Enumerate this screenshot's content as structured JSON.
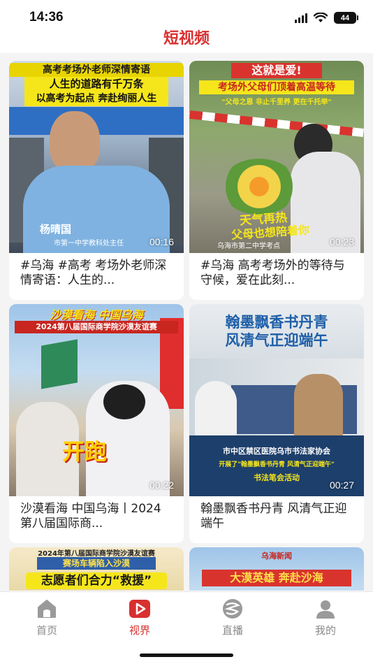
{
  "status_bar": {
    "time": "14:36",
    "battery": "44"
  },
  "header": {
    "title": "短视频"
  },
  "videos": [
    {
      "banner_lines": [
        "高考考场外老师深情寄语",
        "人生的道路有千万条",
        "以高考为起点 奔赴绚丽人生"
      ],
      "overlay_name": "杨晴国",
      "overlay_role": "市第一中学教科处主任",
      "duration": "00:16",
      "caption": "#乌海 #高考 考场外老师深情寄语：人生的..."
    },
    {
      "banner_lines": [
        "这就是爱!",
        "考场外父母们顶着高温等待",
        "\"父母之恩 非止千里养 更在千托举\"",
        "天气再热",
        "父母也想陪着你"
      ],
      "overlay_location": "乌海市第二中学考点",
      "duration": "00:23",
      "caption": "#乌海 高考考场外的等待与守候，爱在此刻..."
    },
    {
      "banner_lines": [
        "沙漠看海 中国乌海",
        "2024第八届国际商学院沙漠友谊赛",
        "开跑"
      ],
      "duration": "00:22",
      "caption": "沙漠看海 中国乌海丨2024 第八届国际商..."
    },
    {
      "banner_lines": [
        "翰墨飘香书丹青",
        "风清气正迎端午",
        "市中区禁区医院乌市书法家协会",
        "开展了\"翰墨飘香书丹青 风清气正迎端午\"",
        "书法笔会活动"
      ],
      "duration": "00:27",
      "caption": "翰墨飘香书丹青  风清气正迎端午"
    },
    {
      "banner_lines": [
        "2024年第八届国际商学院沙漠友谊赛",
        "赛场车辆陷入沙漠",
        "志愿者们合力“救援”"
      ]
    },
    {
      "banner_lines": [
        "乌海新闻",
        "大漠英雄 奔赴沙海"
      ]
    }
  ],
  "tabs": [
    {
      "label": "首页",
      "icon": "home-icon"
    },
    {
      "label": "视界",
      "icon": "play-icon",
      "active": true
    },
    {
      "label": "直播",
      "icon": "live-icon"
    },
    {
      "label": "我的",
      "icon": "user-icon"
    }
  ],
  "colors": {
    "accent": "#d8302f",
    "inactive": "#8a8a8a",
    "background": "#f4f4f4"
  }
}
